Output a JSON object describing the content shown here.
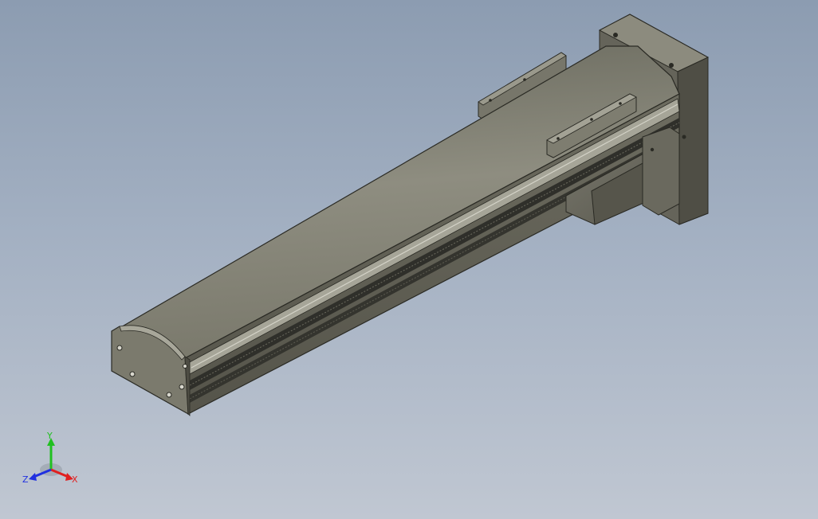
{
  "viewport": {
    "background_top": "#8c9cb1",
    "background_bottom": "#c0c7d2"
  },
  "model": {
    "colors": {
      "body_dark": "#5a5a50",
      "body_mid": "#77766a",
      "body_light": "#9a998c",
      "edge": "#2a2a24",
      "slot": "#2f2f2a"
    }
  },
  "triad": {
    "x_label": "X",
    "y_label": "Y",
    "z_label": "Z",
    "x_color": "#e02020",
    "y_color": "#20c020",
    "z_color": "#2030e0"
  }
}
